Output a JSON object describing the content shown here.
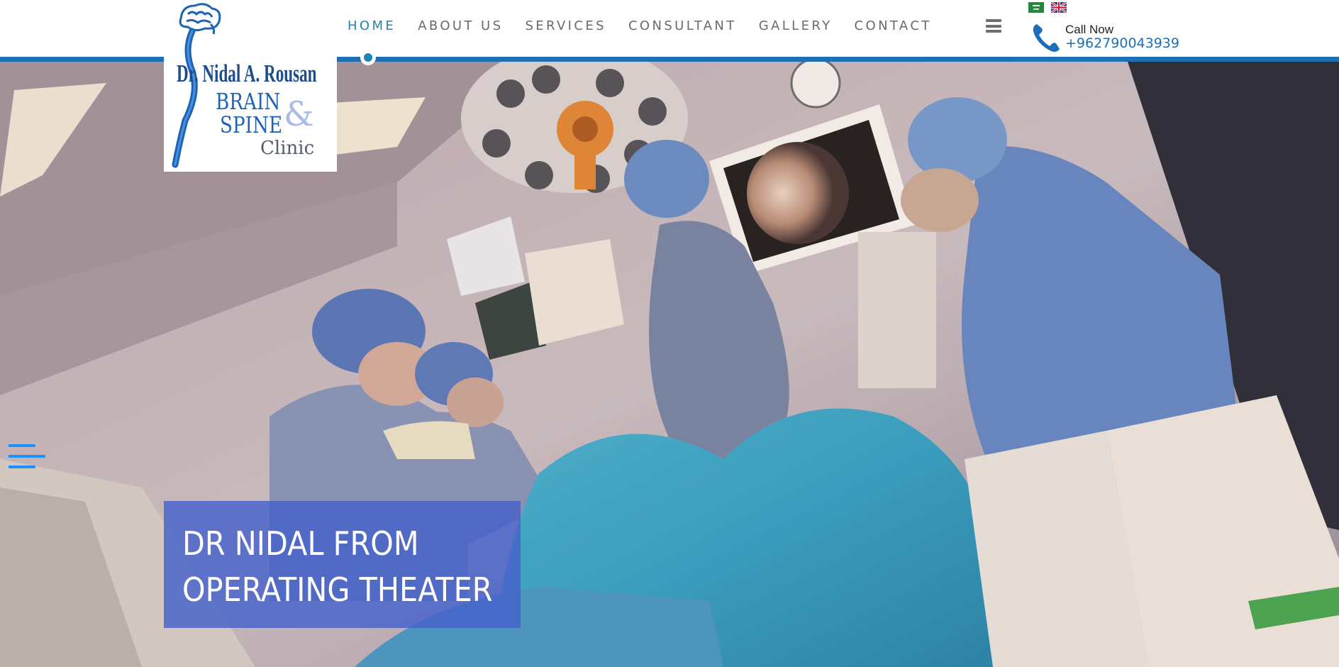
{
  "logo": {
    "name": "Dr. Nidal A. Rousan",
    "line1": "BRAIN",
    "line2": "SPINE",
    "ampersand": "&",
    "line3": "Clinic"
  },
  "nav": {
    "items": [
      {
        "label": "HOME",
        "active": true
      },
      {
        "label": "ABOUT US",
        "active": false
      },
      {
        "label": "SERVICES",
        "active": false
      },
      {
        "label": "CONSULTANT",
        "active": false
      },
      {
        "label": "GALLERY",
        "active": false
      },
      {
        "label": "CONTACT",
        "active": false
      }
    ]
  },
  "header": {
    "call_label": "Call Now",
    "phone": "+962790043939",
    "icons": [
      "menu-icon",
      "arabic-flag-icon",
      "uk-flag-icon",
      "phone-icon"
    ]
  },
  "hero": {
    "caption_line1": "DR NIDAL FROM",
    "caption_line2": "OPERATING THEATER",
    "side_menu_icon": "side-menu-icon"
  },
  "colors": {
    "accent": "#1d86b6",
    "header_rule": "#1f6fb5",
    "caption_bg": "#4662ca",
    "phone_text": "#1b6fb6",
    "nav_text": "#6a6a6a"
  }
}
